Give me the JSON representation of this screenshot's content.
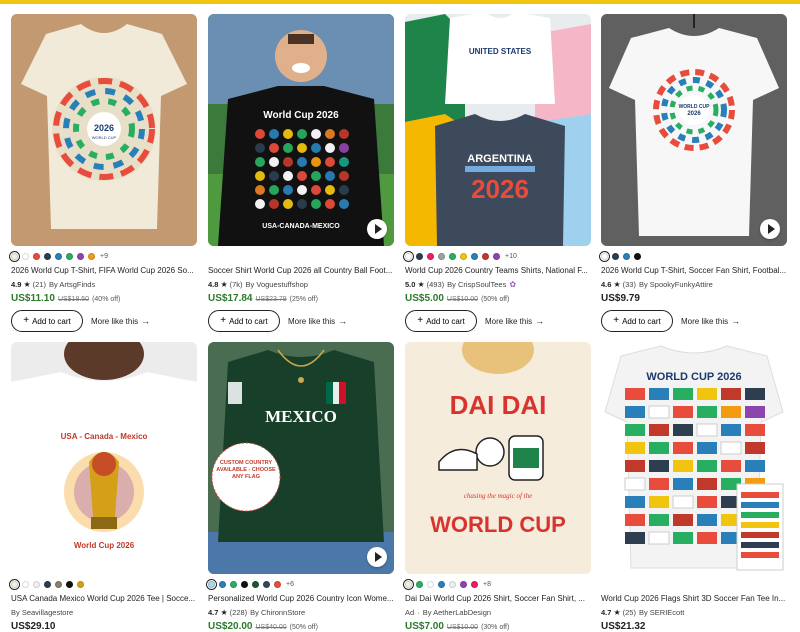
{
  "colors": {
    "topbar": "#f1c40f",
    "sale_price": "#2d7a2d",
    "regular_price": "#222222"
  },
  "actions": {
    "add_to_cart": "Add to cart",
    "more_like_this": "More like this",
    "add_icon": "plus-icon",
    "arrow_icon": "arrow-right-icon"
  },
  "listings": [
    {
      "title": "2026 World Cup T-Shirt, FIFA World Cup 2026 So...",
      "rating": "4.9",
      "reviews": "(21)",
      "shop": "By ArtsgFinds",
      "price": "US$11.10",
      "original_price": "US$18.50",
      "discount": "(40% off)",
      "swatches": [
        "#f4efe1",
        "#ffffff",
        "#e74c3c",
        "#2c3e50",
        "#2980b9",
        "#27ae60",
        "#8e44ad",
        "#f39c12"
      ],
      "more_colors": "+9",
      "image_text": "2026",
      "image_subtext": "WORLD CUP"
    },
    {
      "title": "Soccer Shirt World Cup 2026 all Country Ball Foot...",
      "rating": "4.8",
      "reviews": "(7k)",
      "shop": "By Voguestuffshop",
      "price": "US$17.84",
      "original_price": "US$23.79",
      "discount": "(25% off)",
      "swatches": [],
      "more_colors": "",
      "image_text": "World Cup 2026",
      "image_subtext": "USA-CANADA-MEXICO"
    },
    {
      "title": "World Cup 2026 Country Teams Shirts, National F...",
      "rating": "5.0",
      "reviews": "(493)",
      "shop": "By CrispSoulTees",
      "price": "US$5.00",
      "original_price": "US$10.00",
      "discount": "(50% off)",
      "swatches": [
        "#ffffff",
        "#2c3e50",
        "#e91e63",
        "#95a5a6",
        "#27ae60",
        "#f1c40f",
        "#2980b9",
        "#c0392b",
        "#8e44ad"
      ],
      "more_colors": "+10",
      "image_text": "ARGENTINA",
      "image_subtext": "2026"
    },
    {
      "title": "2026 World Cup T-Shirt, Soccer Fan Shirt, Footbal...",
      "rating": "4.6",
      "reviews": "(33)",
      "shop": "By SpookyFunkyAttire",
      "price": "US$9.79",
      "original_price": "",
      "discount": "",
      "swatches": [
        "#ffffff",
        "#2c3e50",
        "#2980b9",
        "#111111"
      ],
      "more_colors": "",
      "image_text": "WORLD CUP",
      "image_subtext": "2026"
    },
    {
      "title": "USA Canada Mexico World Cup 2026 Tee | Socce...",
      "rating": "",
      "reviews": "",
      "shop": "By Seavillagestore",
      "price": "US$29.10",
      "original_price": "",
      "discount": "",
      "swatches": [
        "#f4efe1",
        "#ffffff",
        "#f1f1f1",
        "#2c3e50",
        "#8e7d6b",
        "#111111",
        "#d4a017"
      ],
      "more_colors": "",
      "image_text": "USA - Canada - Mexico",
      "image_subtext": "World Cup 2026"
    },
    {
      "title": "Personalized World Cup 2026 Country Icon Wome...",
      "rating": "4.7",
      "reviews": "(228)",
      "shop": "By ChironnStore",
      "price": "US$20.00",
      "original_price": "US$40.00",
      "discount": "(50% off)",
      "swatches": [
        "#a8d8ea",
        "#2980b9",
        "#27ae60",
        "#111111",
        "#1e5631",
        "#34495e",
        "#e74c3c"
      ],
      "more_colors": "+6",
      "image_text": "MEXICO",
      "image_subtext": "CUSTOM COUNTRY AVAILABLE - CHOOSE ANY FLAG"
    },
    {
      "title": "Dai Dai World Cup 2026 Shirt, Soccer Fan Shirt, ...",
      "rating": "",
      "reviews": "",
      "shop": "By AetherLabDesign",
      "ad_label": "Ad",
      "price": "US$7.00",
      "original_price": "US$10.00",
      "discount": "(30% off)",
      "swatches": [
        "#f4efe1",
        "#27ae60",
        "#ffffff",
        "#2980b9",
        "#ecf0f1",
        "#8e44ad",
        "#e91e63"
      ],
      "more_colors": "+8",
      "image_text": "DAI DAI",
      "image_subtext": "WORLD CUP"
    },
    {
      "title": "World Cup 2026 Flags Shirt 3D Soccer Fan Tee In...",
      "rating": "4.7",
      "reviews": "(25)",
      "shop": "By SERIEcott",
      "price": "US$21.32",
      "original_price": "",
      "discount": "",
      "swatches": [],
      "more_colors": "",
      "image_text": "WORLD CUP 2026",
      "image_subtext": ""
    }
  ]
}
